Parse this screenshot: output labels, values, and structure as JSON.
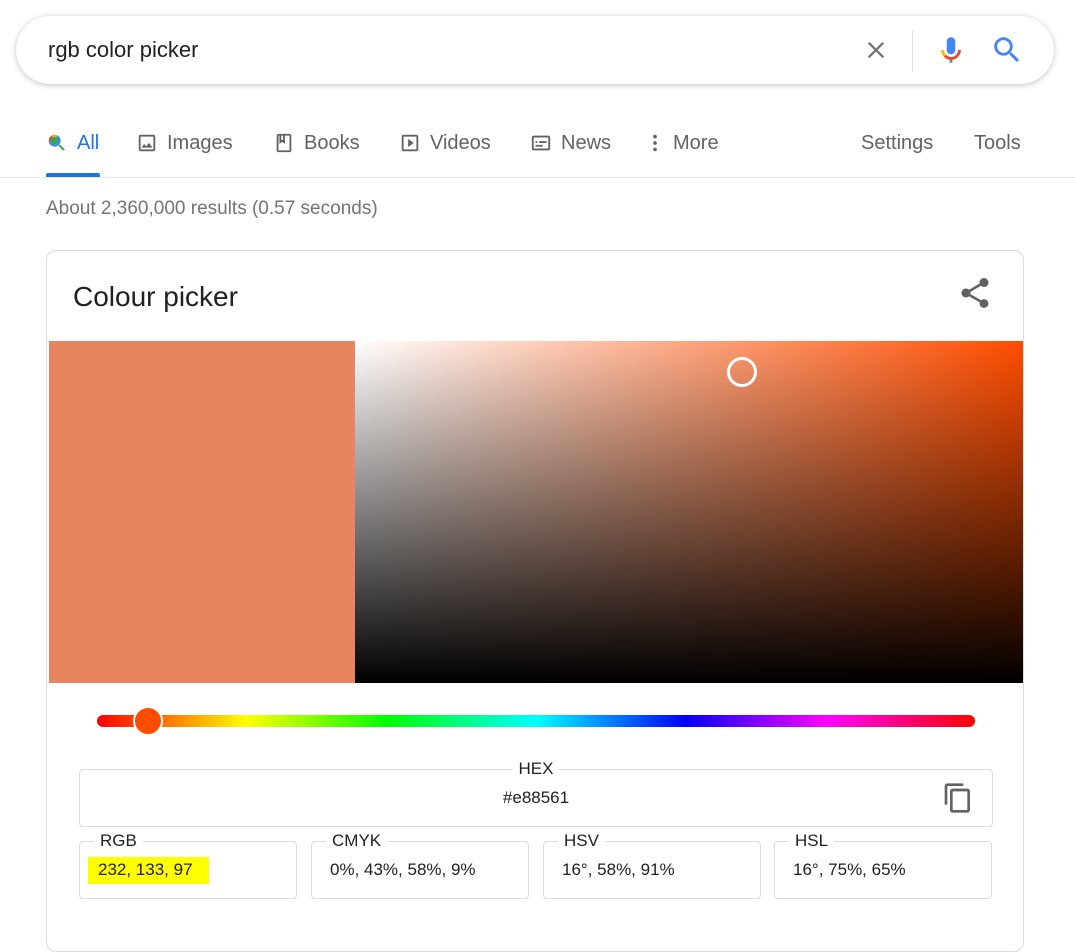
{
  "search": {
    "query": "rgb color picker",
    "icons": {
      "clear": "close-icon",
      "mic": "microphone-icon",
      "search": "search-icon"
    }
  },
  "tabs": [
    {
      "label": "All",
      "icon": "search-icon",
      "active": true
    },
    {
      "label": "Images",
      "icon": "image-icon"
    },
    {
      "label": "Books",
      "icon": "book-icon"
    },
    {
      "label": "Videos",
      "icon": "play-icon"
    },
    {
      "label": "News",
      "icon": "newspaper-icon"
    },
    {
      "label": "More",
      "icon": "more-vertical-icon"
    },
    {
      "label": "Settings"
    },
    {
      "label": "Tools"
    }
  ],
  "results_stats": "About 2,360,000 results (0.57 seconds)",
  "picker": {
    "title": "Colour picker",
    "selected_color": "#e88561",
    "hue_color": "#ff4d00",
    "hue_degrees": 16,
    "saturation_fraction": 0.58,
    "value_fraction": 0.91,
    "hex": {
      "label": "HEX",
      "value": "#e88561"
    },
    "rgb": {
      "label": "RGB",
      "value": "232, 133, 97",
      "highlighted": true
    },
    "cmyk": {
      "label": "CMYK",
      "value": "0%, 43%, 58%, 9%"
    },
    "hsv": {
      "label": "HSV",
      "value": "16°, 58%, 91%"
    },
    "hsl": {
      "label": "HSL",
      "value": "16°, 75%, 65%"
    }
  },
  "colors": {
    "accent": "#1a73e8",
    "highlight": "#ffff00"
  }
}
